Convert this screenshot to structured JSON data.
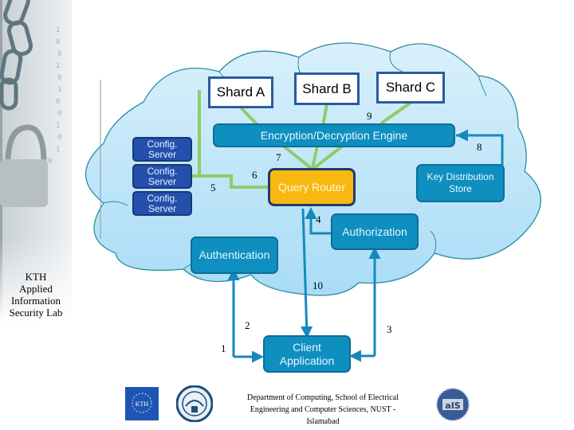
{
  "sidebar": {
    "lab_name_lines": [
      "KTH",
      "Applied",
      "Information",
      "Security Lab"
    ]
  },
  "diagram": {
    "shards": [
      {
        "label": "Shard A"
      },
      {
        "label": "Shard B"
      },
      {
        "label": "Shard C"
      }
    ],
    "encryption_engine": "Encryption/Decryption Engine",
    "config_servers": [
      {
        "line1": "Config.",
        "line2": "Server"
      },
      {
        "line1": "Config.",
        "line2": "Server"
      },
      {
        "line1": "Config.",
        "line2": "Server"
      }
    ],
    "query_router": "Query Router",
    "key_store": {
      "line1": "Key  Distribution",
      "line2": "Store"
    },
    "authorization": "Authorization",
    "authentication": "Authentication",
    "client_app": {
      "line1": "Client",
      "line2": "Application"
    },
    "step_numbers": {
      "s1": "1",
      "s2": "2",
      "s3": "3",
      "s4": "4",
      "s5": "5",
      "s6": "6",
      "s7": "7",
      "s8": "8",
      "s9": "9",
      "s10": "10"
    },
    "colors": {
      "cloud_fill": "#c9e9fb",
      "cloud_stroke": "#2a8da0",
      "green_link": "#8ccd6a",
      "blue_arrow": "#1589bd",
      "teal_box": "#0f8fc0",
      "router": "#f7b911",
      "config": "#2450ab"
    }
  },
  "footer": {
    "lines": [
      "Department of Computing, School of Electrical",
      "Engineering and Computer Sciences, NUST -",
      "Islamabad"
    ],
    "logos": [
      "kth-logo",
      "nust-logo",
      "ais-logo"
    ],
    "kth_text": "KTH",
    "ais_text": "aIS"
  }
}
